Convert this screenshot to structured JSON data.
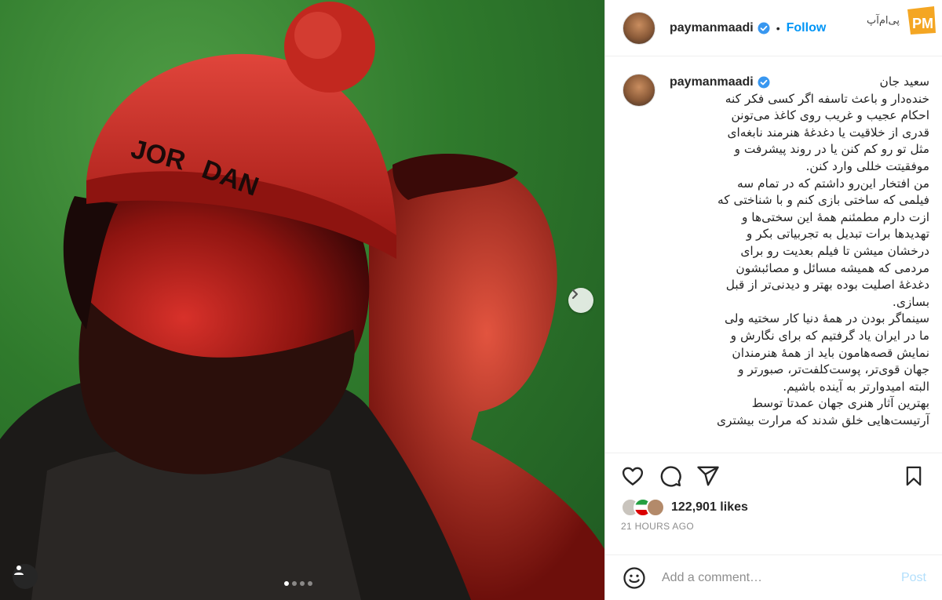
{
  "post": {
    "image_description_alt": "",
    "carousel": {
      "count": 4,
      "active_index": 0
    }
  },
  "header": {
    "username": "paymanmaadi",
    "separator": "•",
    "follow_label": "Follow"
  },
  "watermark": {
    "text": "پی‌ام‌آپ",
    "logo_text": "PM"
  },
  "caption": {
    "username": "paymanmaadi",
    "greeting": "سعید جان",
    "lines": [
      "خنده‌دار و باعث تاسفه اگر کسی فکر کنه",
      "احکام عجیب و غریب روی کاغذ می‌تونن",
      "قدری از خلاقیت یا دغدغهٔ هنرمند نابغه‌ای",
      "مثل تو رو کم کنن یا در روند پیشرفت و",
      "موفقیتت خللی وارد کنن.",
      "من افتخار این‌رو داشتم که در تمام سه",
      "فیلمی که ساختی بازی کنم و با شناختی که",
      "ازت دارم مطمئنم همهٔ این سختی‌ها و",
      "تهدیدها برات تبدیل به تجربیاتی بکر و",
      "درخشان میشن تا فیلم بعدیت رو برای",
      "مردمی که همیشه مسائل و مصائبشون",
      "دغدغهٔ اصلیت بوده بهتر و دیدنی‌تر از قبل",
      "بسازی.",
      "سینماگر بودن در همهٔ دنیا کار سختیه ولی",
      "ما در ایران یاد گرفتیم که برای نگارش و",
      "نمایش قصه‌هامون باید از همهٔ هنرمندان",
      "جهان قوی‌تر، پوست‌کلفت‌تر، صبورتر و",
      "البته امیدوارتر به آینده باشیم.",
      "بهترین آثار هنری جهان عمدتا توسط",
      "آرتیست‌هایی خلق شدند که مرارت بیشتری"
    ]
  },
  "actions": {
    "likes_count": "122,901",
    "likes_suffix": "likes",
    "time_ago": "21 HOURS AGO"
  },
  "comment": {
    "placeholder": "Add a comment…",
    "post_label": "Post"
  },
  "colors": {
    "link_blue": "#0095f6",
    "verified_blue": "#3897f0",
    "post_disabled": "#b2dffc",
    "photo_green": "#2f7a2c",
    "photo_red": "#c0201c"
  },
  "icons": [
    "verified-badge-icon",
    "chevron-right-icon",
    "user-tag-icon",
    "heart-icon",
    "comment-icon",
    "share-icon",
    "bookmark-icon",
    "emoji-icon"
  ]
}
